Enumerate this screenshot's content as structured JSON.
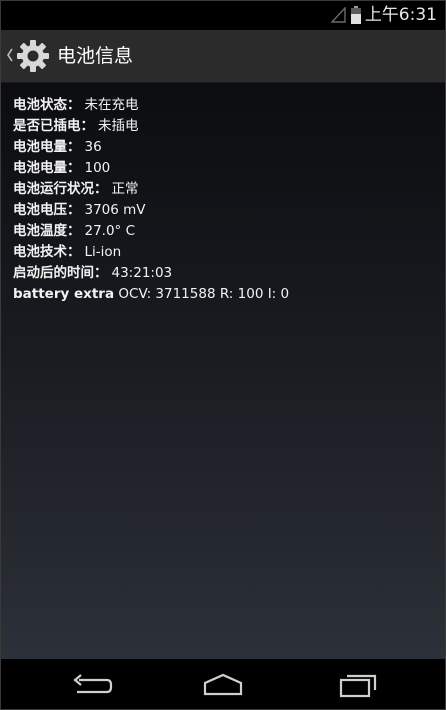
{
  "status_bar": {
    "time": "上午6:31",
    "icons": [
      "signal-icon",
      "battery-icon"
    ]
  },
  "action_bar": {
    "title": "电池信息",
    "icon": "gear-icon",
    "up_icon": "back-caret-icon"
  },
  "battery_info": {
    "rows": [
      {
        "label": "电池状态",
        "value": "未在充电"
      },
      {
        "label": "是否已插电",
        "value": "未插电"
      },
      {
        "label": "电池电量",
        "value": "36"
      },
      {
        "label": "电池电量",
        "value": "100"
      },
      {
        "label": "电池运行状况",
        "value": "正常"
      },
      {
        "label": "电池电压",
        "value": "3706 mV"
      },
      {
        "label": "电池温度",
        "value": "27.0° C"
      },
      {
        "label": "电池技术",
        "value": "Li-ion"
      },
      {
        "label": "启动后的时间",
        "value": "43:21:03"
      }
    ],
    "separator": "：",
    "extra": {
      "label": "battery extra",
      "value": "OCV: 3711588 R: 100 I: 0"
    }
  },
  "nav_bar": {
    "buttons": [
      "back-icon",
      "home-icon",
      "recents-icon"
    ]
  },
  "colors": {
    "action_bar_bg": "#2b2b2b",
    "text": "#f2f2f2",
    "background_top": "#0b0d10",
    "background_bottom": "#2c3038"
  }
}
